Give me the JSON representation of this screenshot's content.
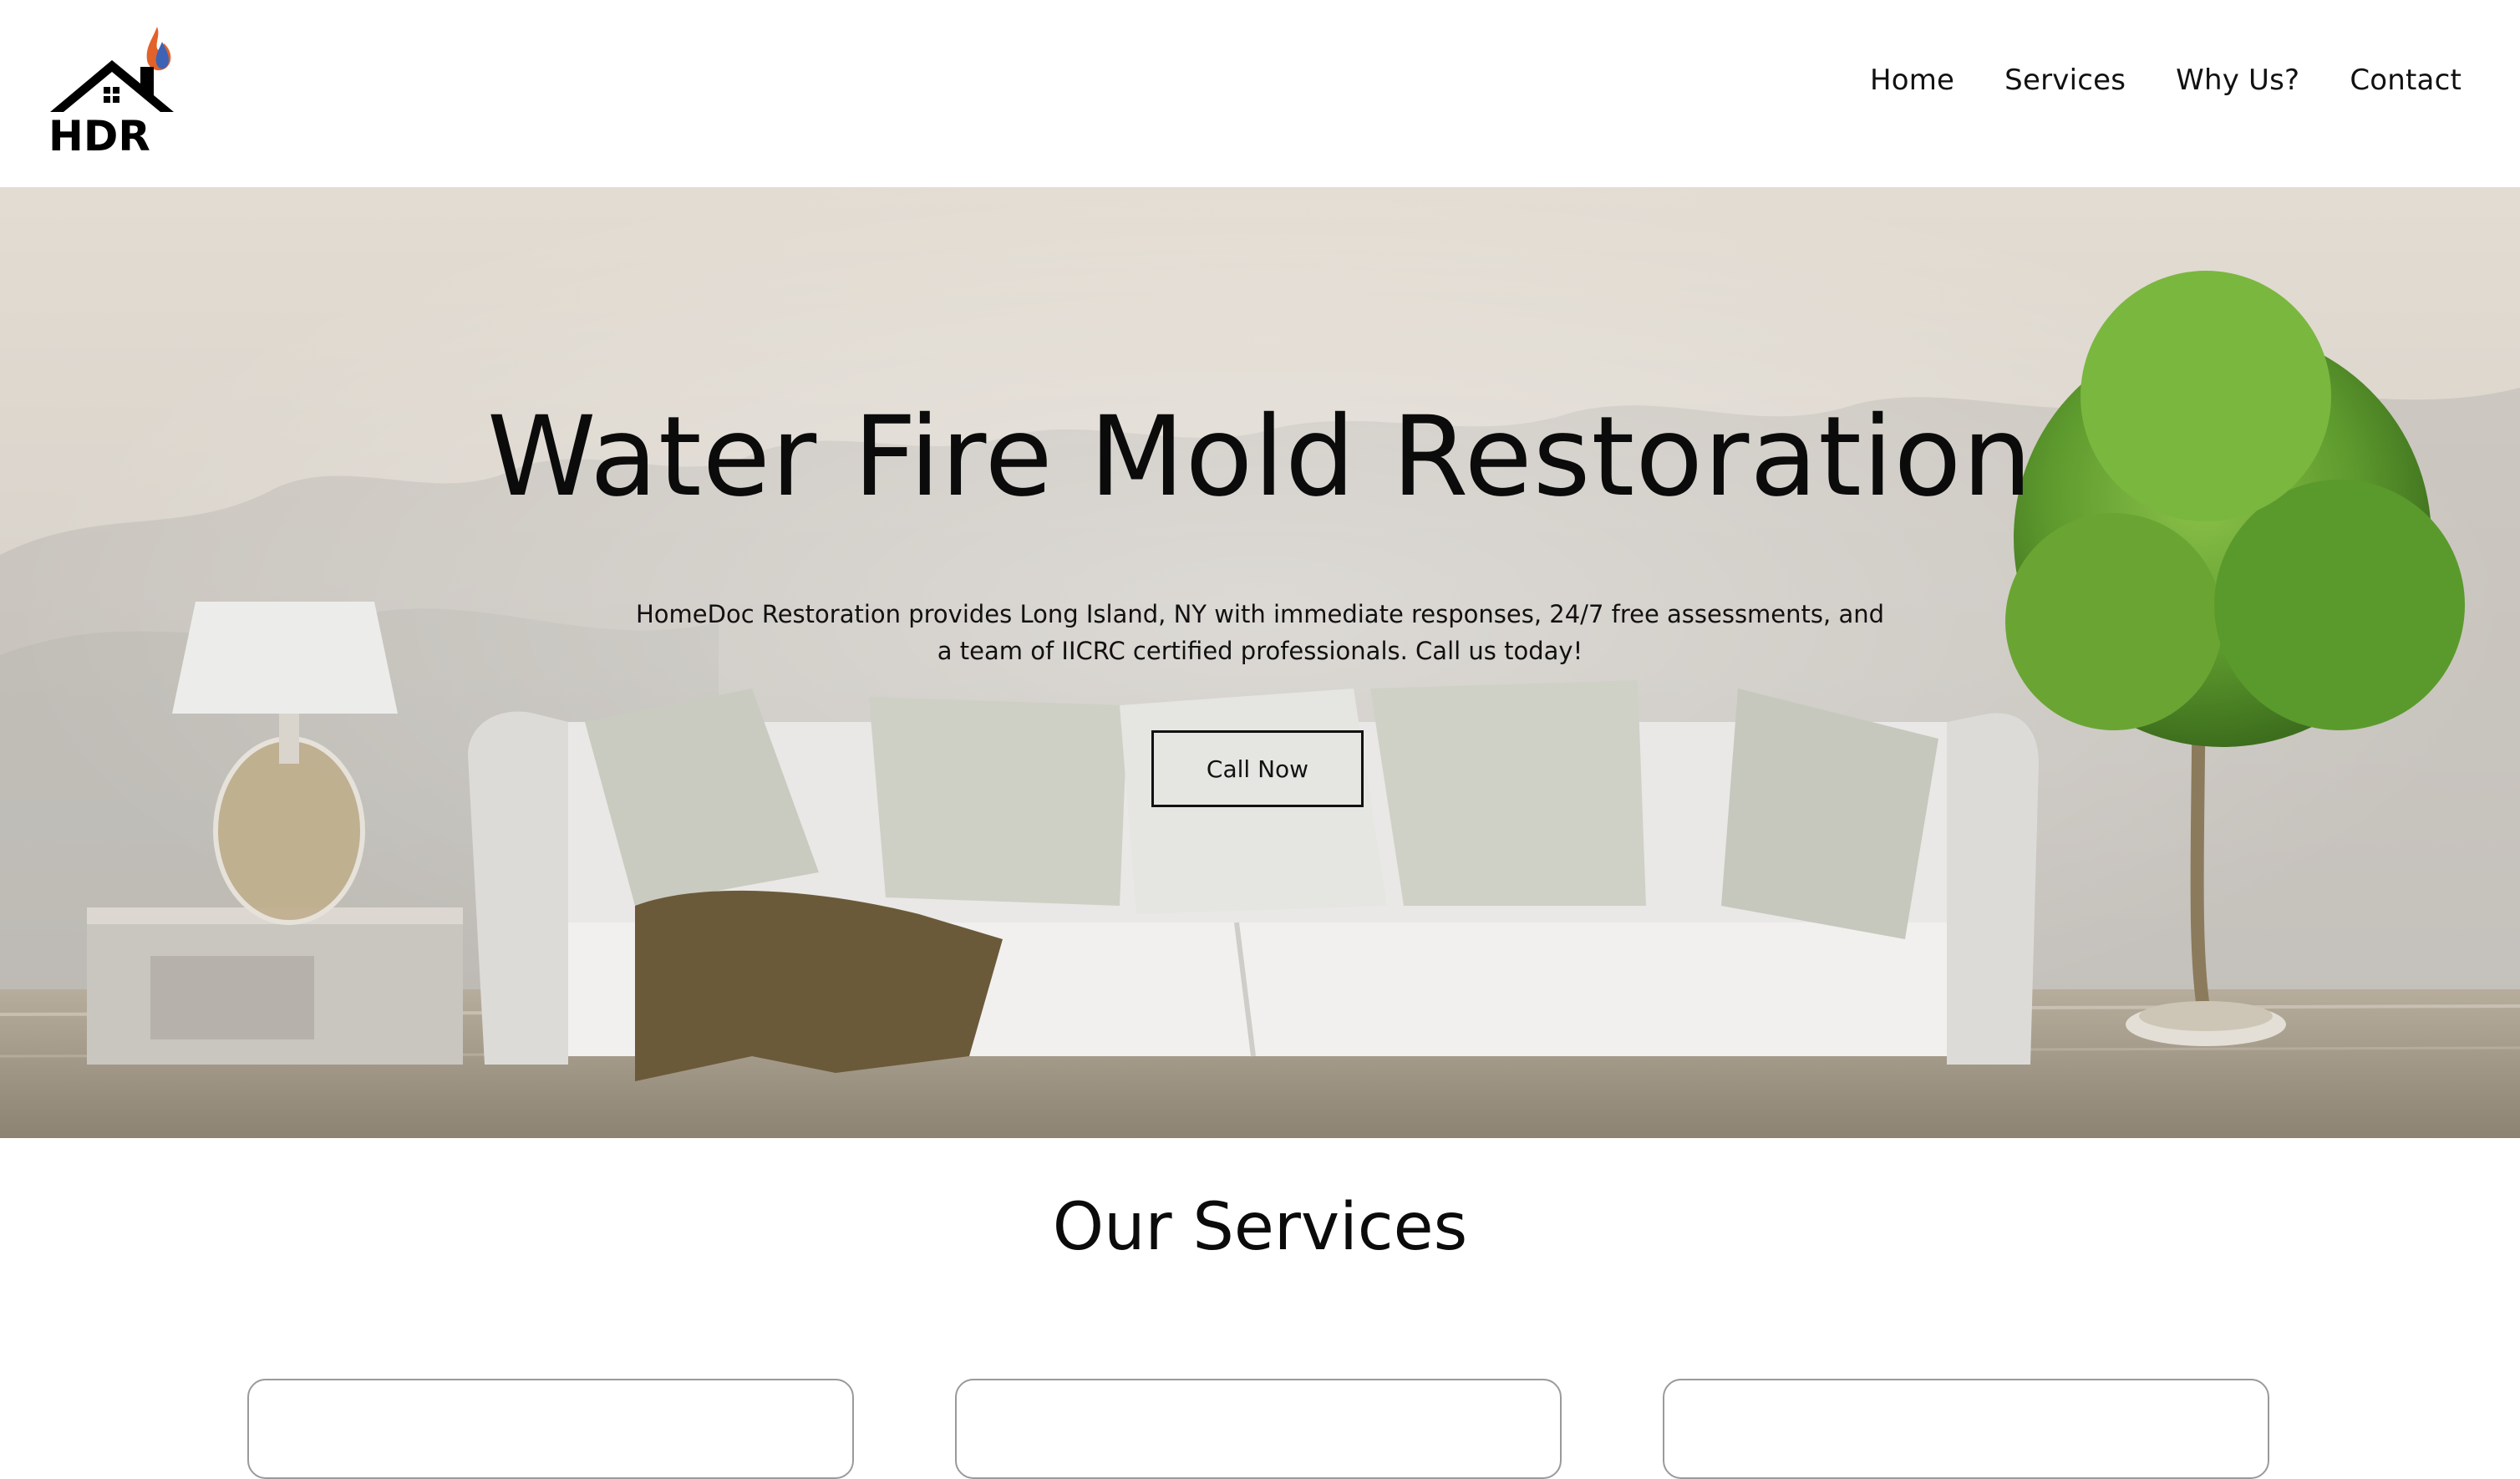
{
  "brand": {
    "logo_text": "HDR"
  },
  "nav": {
    "items": [
      {
        "label": "Home"
      },
      {
        "label": "Services"
      },
      {
        "label": "Why Us?"
      },
      {
        "label": "Contact"
      }
    ]
  },
  "hero": {
    "title": "Water Fire Mold Restoration",
    "description": "HomeDoc Restoration provides Long Island, NY with immediate responses, 24/7 free assessments, and a team of IICRC certified professionals. Call us today!",
    "cta_label": "Call Now"
  },
  "services": {
    "title": "Our Services"
  },
  "colors": {
    "text": "#0b0b0b",
    "background": "#ffffff",
    "flame_orange": "#e2622a",
    "flame_blue": "#3c63b5",
    "plant_green": "#5e9b2e"
  }
}
